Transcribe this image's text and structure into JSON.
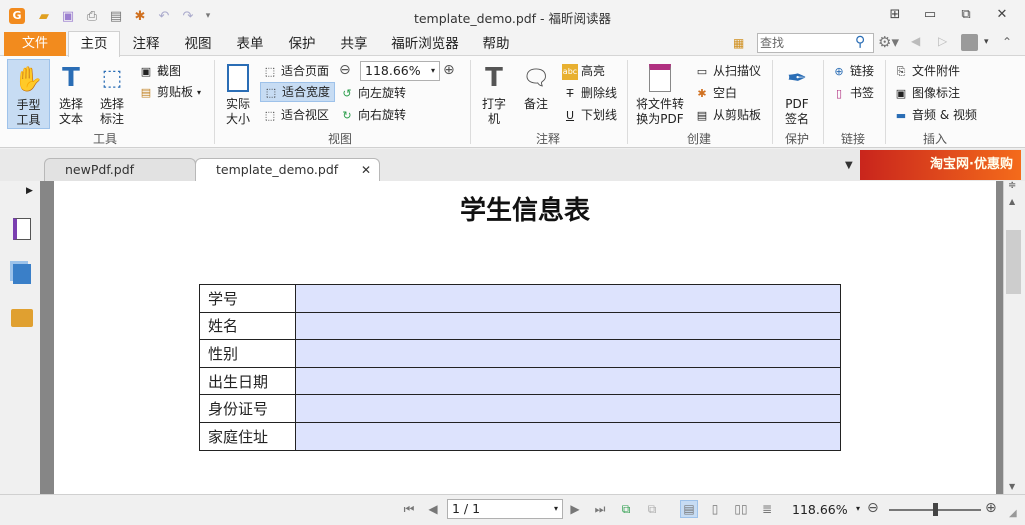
{
  "window": {
    "title": "template_demo.pdf - 福昕阅读器"
  },
  "menu": {
    "file": "文件",
    "tabs": [
      "主页",
      "注释",
      "视图",
      "表单",
      "保护",
      "共享",
      "福昕浏览器",
      "帮助"
    ],
    "search_placeholder": "查找"
  },
  "ribbon": {
    "tools": {
      "hand": "手型工具",
      "select_text": "选择文本",
      "select_annot": "选择标注",
      "group": "工具"
    },
    "clip": {
      "snapshot": "截图",
      "clipboard": "剪贴板"
    },
    "view": {
      "actual": "实际大小",
      "fit_page": "适合页面",
      "fit_width": "适合宽度",
      "fit_visible": "适合视区",
      "zoom": "118.66%",
      "rotate_left": "向左旋转",
      "rotate_right": "向右旋转",
      "group": "视图"
    },
    "annot": {
      "typewriter": "打字机",
      "note": "备注",
      "highlight": "高亮",
      "strikeout": "删除线",
      "underline": "下划线",
      "group": "注释"
    },
    "create": {
      "convert": "将文件转换为PDF",
      "from_scanner": "从扫描仪",
      "blank": "空白",
      "from_clipboard": "从剪贴板",
      "group": "创建"
    },
    "protect": {
      "sign": "PDF签名",
      "group": "保护"
    },
    "links": {
      "link": "链接",
      "bookmark": "书签",
      "group": "链接"
    },
    "insert": {
      "attach": "文件附件",
      "image": "图像标注",
      "av": "音频 & 视频",
      "group": "插入"
    }
  },
  "doc_tabs": [
    "newPdf.pdf",
    "template_demo.pdf"
  ],
  "ad": {
    "text": "淘宝网·优惠购"
  },
  "document": {
    "title": "学生信息表",
    "rows": [
      "学号",
      "姓名",
      "性别",
      "出生日期",
      "身份证号",
      "家庭住址"
    ]
  },
  "status": {
    "page": "1 / 1",
    "zoom": "118.66%"
  },
  "colors": {
    "accent": "#f28b1e",
    "field": "#dde3fd"
  }
}
